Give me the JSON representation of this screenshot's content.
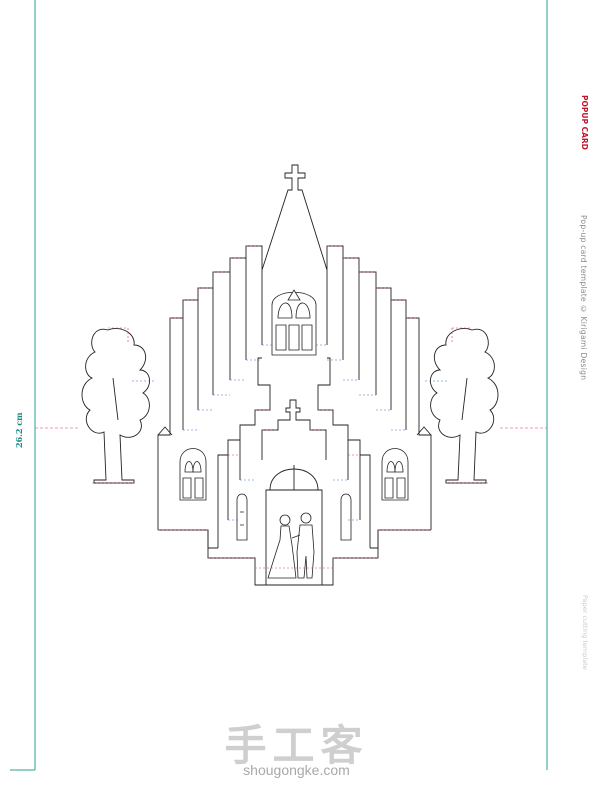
{
  "sheet": {
    "dimension_label": "26.2 cm",
    "side_credit": "Pop-up card template © Kirigami Design",
    "side_brand": "POPUP CARD",
    "side_faint": "Paper cutting template"
  },
  "watermark": {
    "chinese": "手工客",
    "site": "shougongke.com"
  },
  "colors": {
    "border": "#2e9c95",
    "cut_line": "#1a1a1a",
    "mountain_fold": "#e03a4a",
    "valley_fold": "#3a6fd0"
  }
}
